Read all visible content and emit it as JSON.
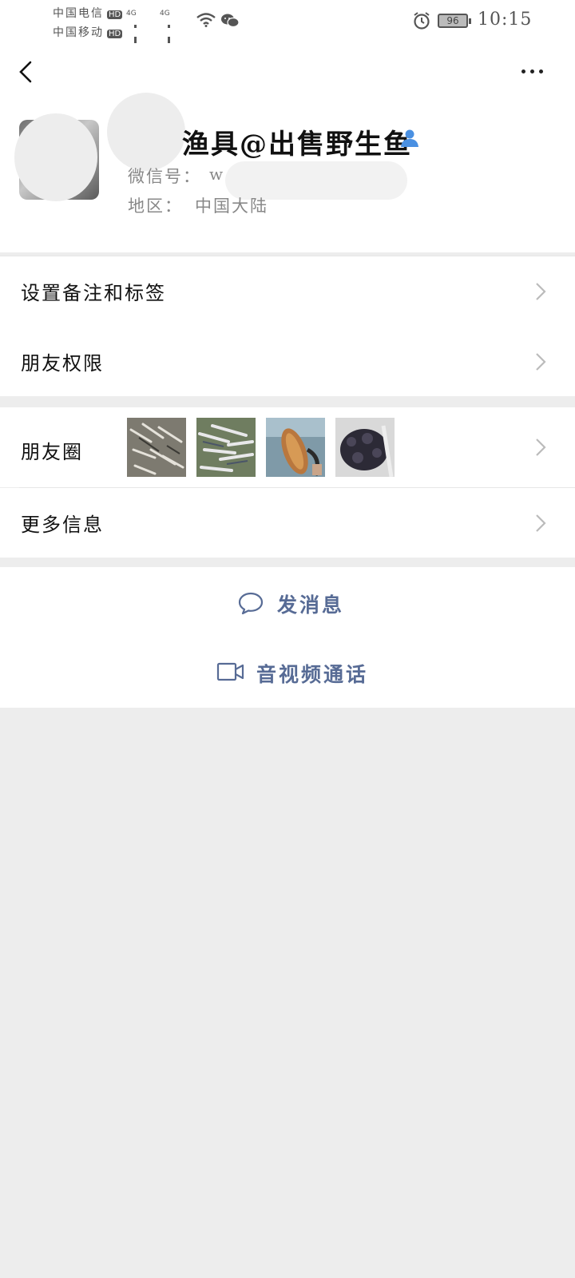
{
  "status_bar": {
    "carrier1": "中国电信",
    "carrier2": "中国移动",
    "hd_badge": "HD",
    "network1": "4G",
    "network2": "4G",
    "battery_level": "96",
    "time": "10:15"
  },
  "profile": {
    "nickname": "渔具@出售野生鱼",
    "wechat_id_label": "微信号：",
    "wechat_id_value": "w",
    "region_label": "地区：",
    "region_value": "中国大陆"
  },
  "menu": {
    "remark_tags": "设置备注和标签",
    "friend_permissions": "朋友权限",
    "moments": "朋友圈",
    "more_info": "更多信息"
  },
  "actions": {
    "send_message": "发消息",
    "video_call": "音视频通话"
  },
  "colors": {
    "link_blue": "#576b95",
    "background": "#ededed",
    "contact_icon_blue": "#4a90e2"
  },
  "icons": [
    "back-arrow-icon",
    "more-dots-icon",
    "contact-person-icon",
    "chevron-right-icon",
    "chat-bubble-icon",
    "video-camera-icon",
    "wifi-icon",
    "wechat-icon",
    "alarm-icon",
    "battery-icon"
  ]
}
